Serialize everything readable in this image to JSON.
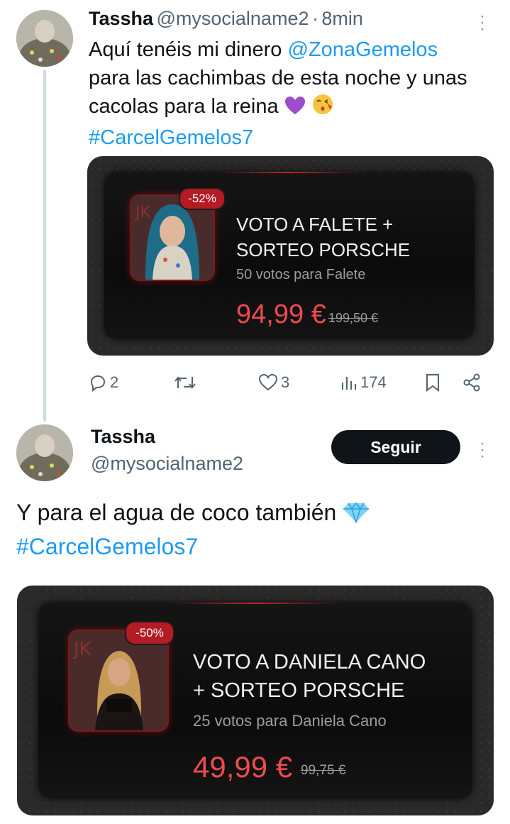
{
  "tweet1": {
    "name": "Tassha",
    "handle": "@mysocialname2",
    "sep": "·",
    "time": "8min",
    "text_line1_pre": "Aquí tenéis mi dinero ",
    "mention": "@ZonaGemelos",
    "text_line2": "para las cachimbas de esta noche y unas",
    "text_line3": "cacolas para la reina",
    "hashtag": "#CarcelGemelos7",
    "emojis": [
      "purple-heart",
      "kissing-face"
    ],
    "card": {
      "badge": "-52%",
      "title_line1": "VOTO A FALETE +",
      "title_line2": "SORTEO PORSCHE",
      "subtitle": "50 votos para Falete",
      "price": "94,99 €",
      "old_price": "199,50 €"
    },
    "actions": {
      "replies": "2",
      "retweets": "",
      "likes": "3",
      "views": "174"
    }
  },
  "tweet2": {
    "name": "Tassha",
    "handle": "@mysocialname2",
    "follow_label": "Seguir",
    "text_line1": "Y para el agua de coco también",
    "emoji": "gem",
    "hashtag": "#CarcelGemelos7",
    "card": {
      "badge": "-50%",
      "title_line1": "VOTO A DANIELA CANO",
      "title_line2": "+ SORTEO PORSCHE",
      "subtitle": "25 votos para Daniela Cano",
      "price": "49,99 €",
      "old_price": "99,75 €"
    }
  },
  "colors": {
    "link": "#1d9bf0",
    "price_red": "#ef4a4f",
    "badge_red": "#b31b25",
    "text_secondary": "#536471"
  }
}
